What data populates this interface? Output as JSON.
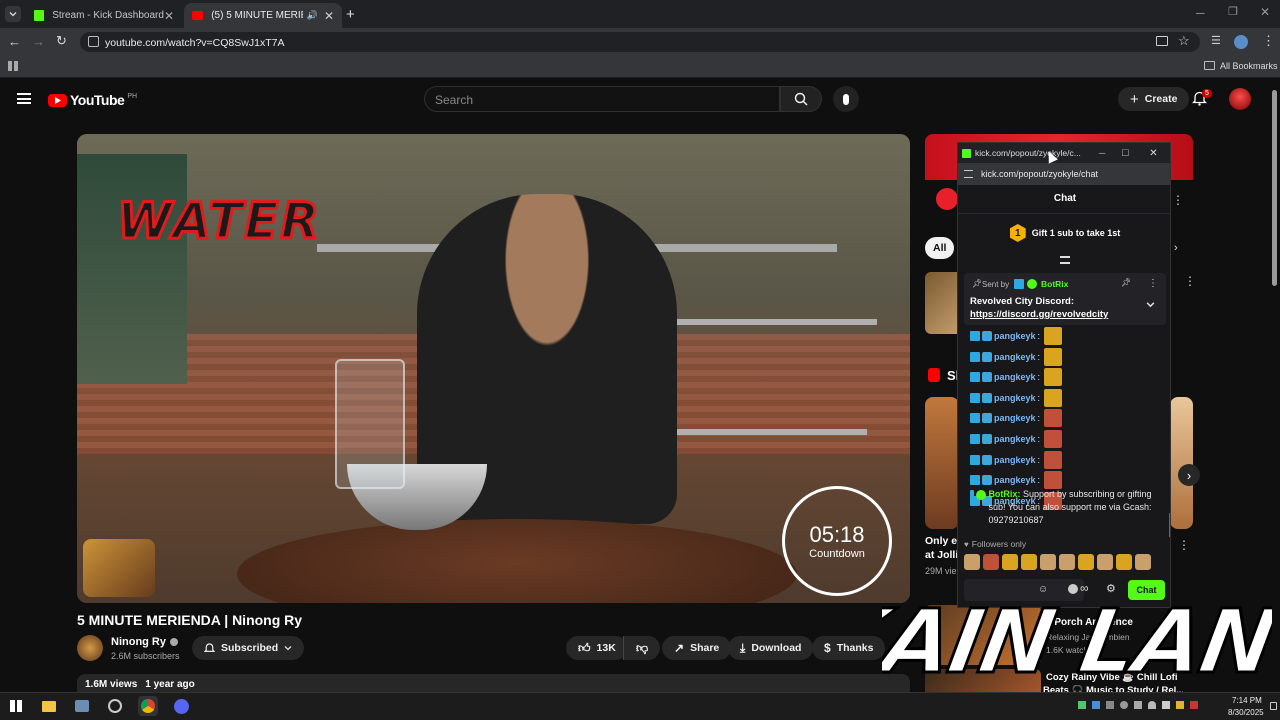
{
  "browser": {
    "tabs": [
      {
        "title": "Stream - Kick Dashboard",
        "active": false
      },
      {
        "title": "(5) 5 MINUTE MERIENDA | N",
        "active": true
      }
    ],
    "url": "youtube.com/watch?v=CQ8SwJ1xT7A",
    "bookmarks_label": "All Bookmarks"
  },
  "youtube": {
    "logo_text": "YouTube",
    "region": "PH",
    "search_placeholder": "Search",
    "create_label": "Create",
    "notification_count": "5",
    "video_overlay_text": "WATER",
    "timer_value": "05:18",
    "timer_label": "Countdown",
    "video_title": "5 MINUTE MERIENDA | Ninong Ry",
    "channel_name": "Ninong Ry",
    "subscribers": "2.6M subscribers",
    "subscribed_label": "Subscribed",
    "likes": "13K",
    "share_label": "Share",
    "download_label": "Download",
    "thanks_label": "Thanks",
    "views": "1.6M views",
    "age": "1 year ago",
    "filter_all": "All",
    "sidebar_shorts_fragment": "Sh",
    "sidebar_item1_title": "Only ea",
    "sidebar_item1_title2": "at Jolli",
    "sidebar_item1_meta": "29M vie",
    "sidebar_item2_title": "ll Porch Ambience",
    "sidebar_item2_meta1": "Relaxing Jazz Ambien",
    "sidebar_item2_meta2": "1.6K watching",
    "sidebar_item3_title": "Cozy Rainy Vibe ☕ Chill Lofi",
    "sidebar_item3_title2": "Beats 🎧 Music to Study / Rel..."
  },
  "kick_popup": {
    "window_title": "kick.com/popout/zyokyle/c...",
    "url": "kick.com/popout/zyokyle/chat",
    "header": "Chat",
    "gift_number": "1",
    "gift_text": "Gift 1 sub to take 1st",
    "pinned_sent_by": "Sent by",
    "pinned_user": "BotRix",
    "pinned_message_title": "Revolved City Discord:",
    "pinned_link": "https://discord.gg/revolvedcity",
    "messages": [
      {
        "user": "pangkeyk",
        "sep": ":"
      },
      {
        "user": "pangkeyk",
        "sep": ":"
      },
      {
        "user": "pangkeyk",
        "sep": ":"
      },
      {
        "user": "pangkeyk",
        "sep": ":"
      },
      {
        "user": "pangkeyk",
        "sep": ":"
      },
      {
        "user": "pangkeyk",
        "sep": ":"
      },
      {
        "user": "pangkeyk",
        "sep": ":"
      },
      {
        "user": "pangkeyk",
        "sep": ":"
      },
      {
        "user": "pangkeyk",
        "sep": ":"
      }
    ],
    "bot_user": "BotRix",
    "bot_message": "Support by subscribing or gifting sub! You can also support me via Gcash: 09279210687",
    "followers_only": "Followers only",
    "chat_button": "Chat"
  },
  "overlay_text": "KAIN LANG",
  "taskbar": {
    "time": "7:14 PM",
    "date": "8/30/2025"
  },
  "colors": {
    "kick_green": "#53fc18",
    "yt_red": "#ff0000",
    "chrome_dark": "#202124"
  }
}
